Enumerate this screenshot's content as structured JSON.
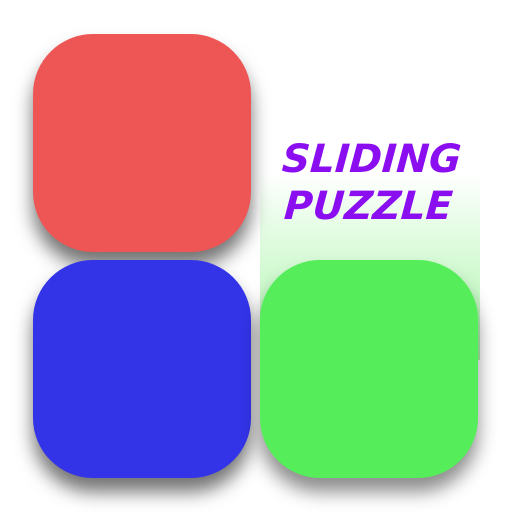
{
  "title": {
    "line1": "SLIDING",
    "line2": "PUZZLE"
  },
  "colors": {
    "red_tile": "#ee5656",
    "blue_tile": "#3333e8",
    "green_tile": "#55ee5a",
    "title": "#8a0ef0",
    "background": "#ffffff"
  },
  "tiles": [
    {
      "name": "red",
      "row": 1,
      "col": 1
    },
    {
      "name": "blue",
      "row": 2,
      "col": 1
    },
    {
      "name": "green",
      "row": 2,
      "col": 2
    }
  ],
  "empty_slot": {
    "row": 1,
    "col": 2
  }
}
